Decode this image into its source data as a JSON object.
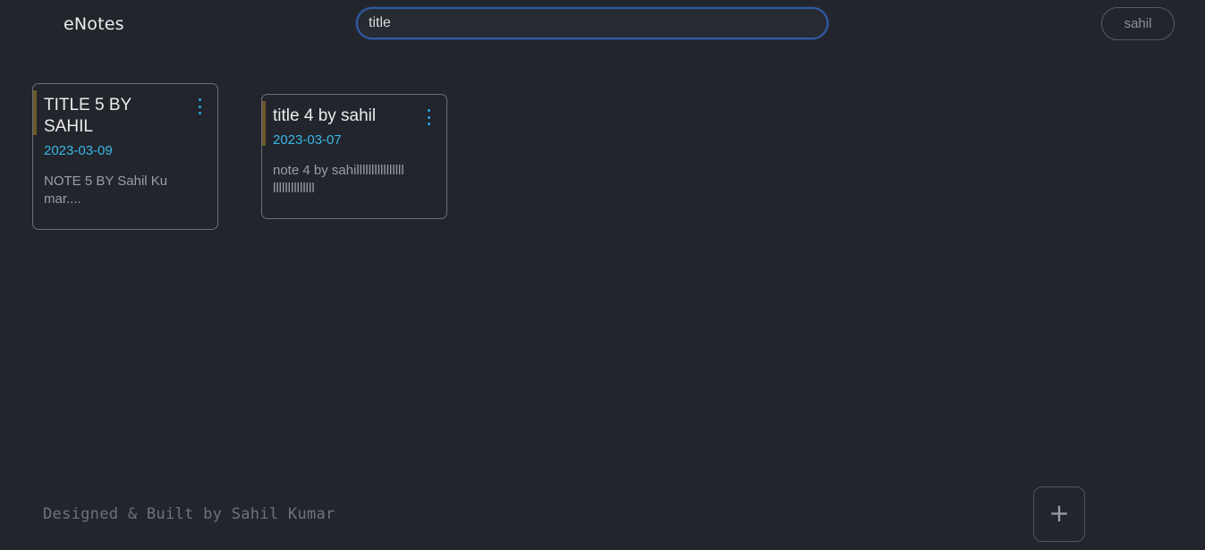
{
  "header": {
    "brand": "eNotes",
    "search": {
      "value": "title",
      "placeholder": ""
    },
    "user_button": "sahil"
  },
  "notes": [
    {
      "title": "TITLE 5 BY SAHIL",
      "date": "2023-03-09",
      "body": "NOTE 5 BY Sahil Kumar....",
      "accent_color": "#6b5a2a"
    },
    {
      "title": "title 4 by sahil",
      "date": "2023-03-07",
      "body": "note 4 by sahillllllllllllllllllllllllllllll",
      "accent_color": "#6b5a2a"
    }
  ],
  "footer": {
    "credit": "Designed & Built by Sahil Kumar"
  },
  "add_button": {
    "label": "+",
    "icon": "plus-icon"
  },
  "colors": {
    "background": "#22252c",
    "accent_blue": "#39b7e6",
    "search_focus": "#2f5aa6"
  }
}
